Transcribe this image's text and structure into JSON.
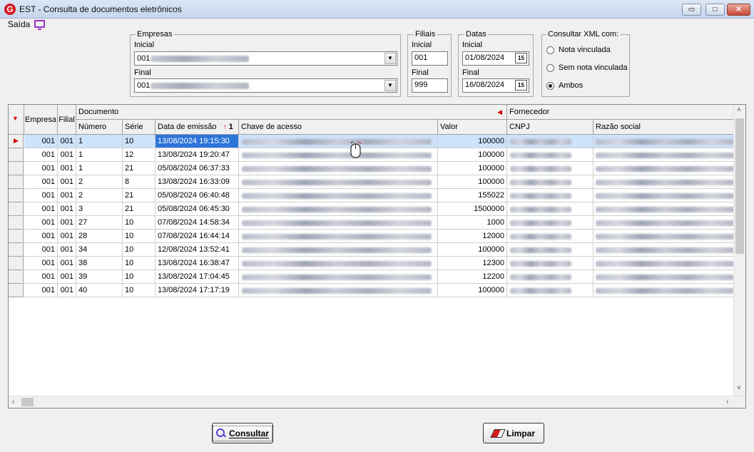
{
  "window": {
    "title": "EST - Consulta de documentos eletrônicos",
    "logo": "G",
    "min_glyph": "▭",
    "max_glyph": "□",
    "close_glyph": "✕"
  },
  "menu": {
    "saida": "Saída",
    "monitor_icon": "monitor-icon"
  },
  "empresas": {
    "legend": "Empresas",
    "inicial_label": "Inicial",
    "inicial_value": "001",
    "final_label": "Final",
    "final_value": "001"
  },
  "filiais": {
    "legend": "Filiais",
    "inicial_label": "Inicial",
    "inicial_value": "001",
    "final_label": "Final",
    "final_value": "999"
  },
  "datas": {
    "legend": "Datas",
    "inicial_label": "Inicial",
    "inicial_value": "01/08/2024",
    "final_label": "Final",
    "final_value": "16/08/2024",
    "calendar_glyph": "15"
  },
  "xml": {
    "legend": "Consultar XML com:",
    "options": [
      "Nota vinculada",
      "Sem nota vinculada",
      "Ambos"
    ],
    "selected": "Ambos"
  },
  "grid": {
    "group_documento": "Documento",
    "group_fornecedor": "Fornecedor",
    "headers": {
      "empresa": "Empresa",
      "filial": "Filial",
      "numero": "Número",
      "serie": "Série",
      "data": "Data de emissão",
      "sort_index": "1",
      "chave": "Chave de acesso",
      "valor": "Valor",
      "cnpj": "CNPJ",
      "razao": "Razão social"
    },
    "rows": [
      {
        "empresa": "001",
        "filial": "001",
        "numero": "1",
        "serie": "10",
        "data": "13/08/2024 19:15:30",
        "valor": "100000"
      },
      {
        "empresa": "001",
        "filial": "001",
        "numero": "1",
        "serie": "12",
        "data": "13/08/2024 19:20:47",
        "valor": "100000"
      },
      {
        "empresa": "001",
        "filial": "001",
        "numero": "1",
        "serie": "21",
        "data": "05/08/2024 06:37:33",
        "valor": "100000"
      },
      {
        "empresa": "001",
        "filial": "001",
        "numero": "2",
        "serie": "8",
        "data": "13/08/2024 16:33:09",
        "valor": "100000"
      },
      {
        "empresa": "001",
        "filial": "001",
        "numero": "2",
        "serie": "21",
        "data": "05/08/2024 06:40:48",
        "valor": "155022"
      },
      {
        "empresa": "001",
        "filial": "001",
        "numero": "3",
        "serie": "21",
        "data": "05/08/2024 06:45:30",
        "valor": "1500000"
      },
      {
        "empresa": "001",
        "filial": "001",
        "numero": "27",
        "serie": "10",
        "data": "07/08/2024 14:58:34",
        "valor": "1000"
      },
      {
        "empresa": "001",
        "filial": "001",
        "numero": "28",
        "serie": "10",
        "data": "07/08/2024 16:44:14",
        "valor": "12000"
      },
      {
        "empresa": "001",
        "filial": "001",
        "numero": "34",
        "serie": "10",
        "data": "12/08/2024 13:52:41",
        "valor": "100000"
      },
      {
        "empresa": "001",
        "filial": "001",
        "numero": "38",
        "serie": "10",
        "data": "13/08/2024 16:38:47",
        "valor": "12300"
      },
      {
        "empresa": "001",
        "filial": "001",
        "numero": "39",
        "serie": "10",
        "data": "13/08/2024 17:04:45",
        "valor": "12200"
      },
      {
        "empresa": "001",
        "filial": "001",
        "numero": "40",
        "serie": "10",
        "data": "13/08/2024 17:17:19",
        "valor": "100000"
      }
    ]
  },
  "buttons": {
    "consultar": "Consultar",
    "limpar": "Limpar"
  }
}
